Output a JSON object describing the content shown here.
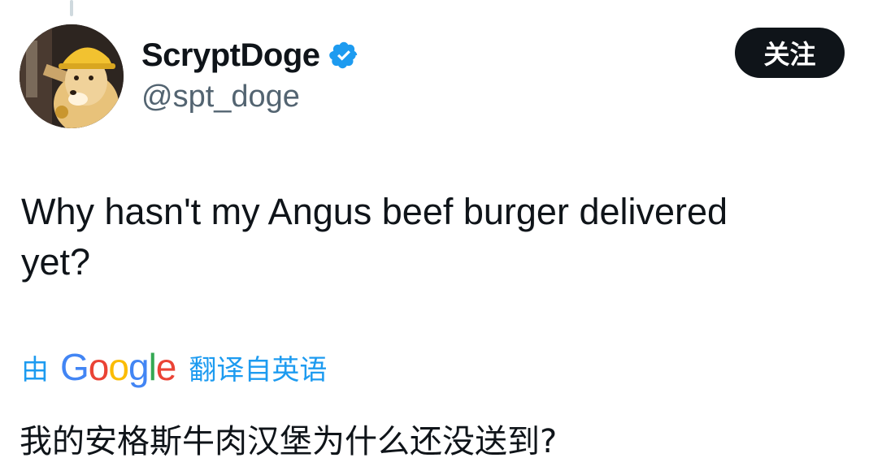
{
  "tweet": {
    "author": {
      "display_name": "ScryptDoge",
      "handle": "@spt_doge",
      "verified": true,
      "avatar_icon": "doge-hardhat-avatar"
    },
    "follow_button_label": "关注",
    "text_line1": "Why hasn't my Angus beef burger delivered",
    "text_line2": "yet?",
    "translation": {
      "by_label": "由",
      "provider_letters": [
        "G",
        "o",
        "o",
        "g",
        "l",
        "e"
      ],
      "from_label": "翻译自英语",
      "translated_text": "我的安格斯牛肉汉堡为什么还没送到?"
    }
  },
  "colors": {
    "text_primary": "#0f1419",
    "text_secondary": "#536471",
    "link_blue": "#1d9bf0",
    "verified_blue": "#1d9bf0",
    "follow_bg": "#0f1419"
  }
}
